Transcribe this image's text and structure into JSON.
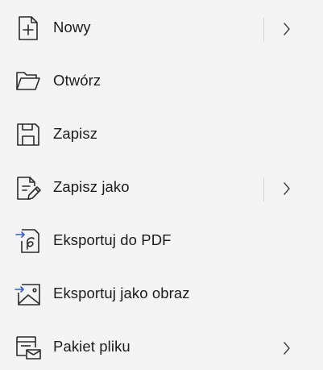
{
  "menu": {
    "items": [
      {
        "label": "Nowy",
        "icon": "new-document-icon",
        "has_submenu": true
      },
      {
        "label": "Otwórz",
        "icon": "folder-open-icon",
        "has_submenu": false
      },
      {
        "label": "Zapisz",
        "icon": "save-icon",
        "has_submenu": false
      },
      {
        "label": "Zapisz jako",
        "icon": "save-as-icon",
        "has_submenu": true
      },
      {
        "label": "Eksportuj do PDF",
        "icon": "export-pdf-icon",
        "has_submenu": false
      },
      {
        "label": "Eksportuj jako obraz",
        "icon": "export-image-icon",
        "has_submenu": false
      },
      {
        "label": "Pakiet pliku",
        "icon": "file-package-icon",
        "has_submenu": true
      }
    ]
  },
  "colors": {
    "background": "#f4f4f4",
    "text": "#1b1b1b",
    "icon_stroke": "#2b2b2b",
    "accent_arrow": "#2f5fd0",
    "separator": "#d6d6d6"
  }
}
